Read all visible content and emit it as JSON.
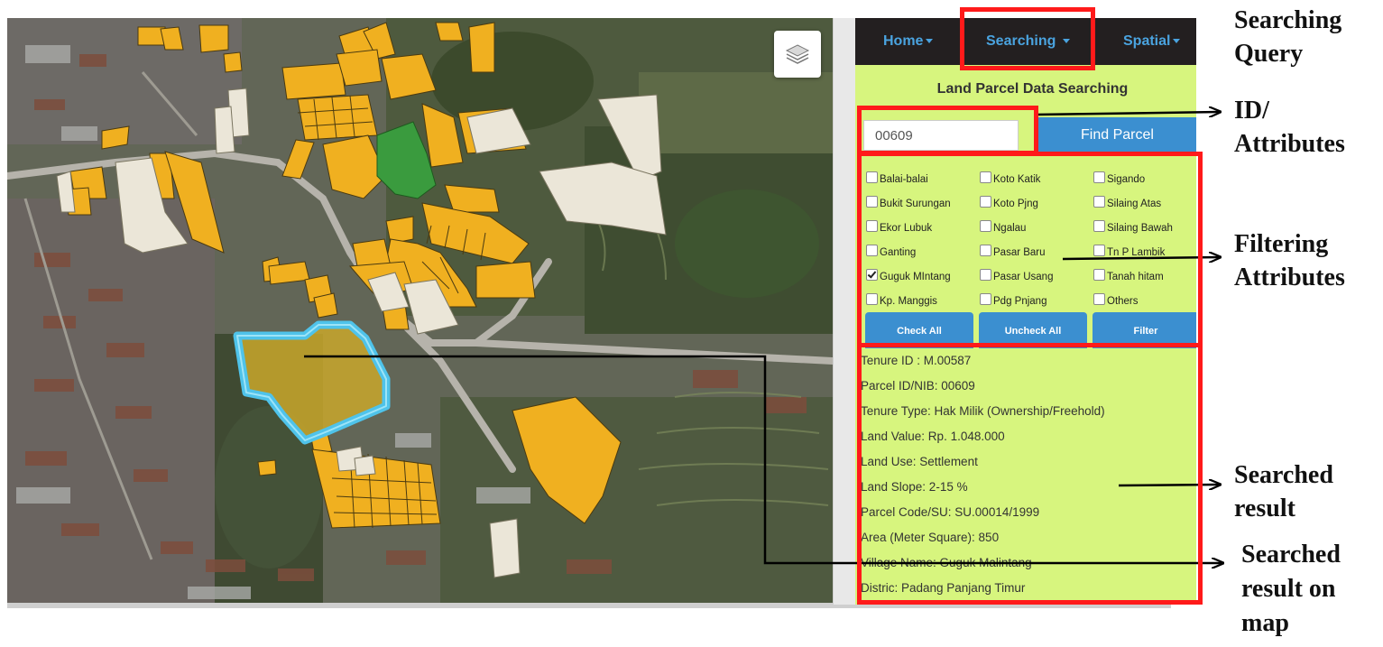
{
  "map": {
    "layers_button_icon": "layers-icon"
  },
  "nav": {
    "home": "Home",
    "searching": "Searching",
    "spatial": "Spatial"
  },
  "panel": {
    "title": "Land Parcel Data Searching",
    "id_input_value": "00609",
    "find_button": "Find Parcel"
  },
  "villages": [
    {
      "label": "Balai-balai",
      "checked": false
    },
    {
      "label": "Koto Katik",
      "checked": false
    },
    {
      "label": "Sigando",
      "checked": false
    },
    {
      "label": "Bukit Surungan",
      "checked": false
    },
    {
      "label": "Koto Pjng",
      "checked": false
    },
    {
      "label": "Silaing Atas",
      "checked": false
    },
    {
      "label": "Ekor Lubuk",
      "checked": false
    },
    {
      "label": "Ngalau",
      "checked": false
    },
    {
      "label": "Silaing Bawah",
      "checked": false
    },
    {
      "label": "Ganting",
      "checked": false
    },
    {
      "label": "Pasar Baru",
      "checked": false
    },
    {
      "label": "Tn P Lambik",
      "checked": false
    },
    {
      "label": "Guguk MIntang",
      "checked": true
    },
    {
      "label": "Pasar Usang",
      "checked": false
    },
    {
      "label": "Tanah hitam",
      "checked": false
    },
    {
      "label": "Kp. Manggis",
      "checked": false
    },
    {
      "label": "Pdg Pnjang",
      "checked": false
    },
    {
      "label": "Others",
      "checked": false
    }
  ],
  "buttons": {
    "check_all": "Check All",
    "uncheck_all": "Uncheck All",
    "filter": "Filter"
  },
  "result": [
    "Tenure ID : M.00587",
    "Parcel ID/NIB: 00609",
    "Tenure Type: Hak Milik (Ownership/Freehold)",
    "Land Value: Rp. 1.048.000",
    "Land Use: Settlement",
    "Land Slope: 2-15 %",
    "Parcel Code/SU: SU.00014/1999",
    "Area (Meter Square): 850",
    "Village Name: Guguk Malintang",
    "Distric: Padang Panjang Timur"
  ],
  "annotations": {
    "searching_query": [
      "Searching",
      "Query"
    ],
    "id_attributes": [
      "ID/",
      "Attributes"
    ],
    "filtering_attributes": [
      "Filtering",
      "Attributes"
    ],
    "searched_result": [
      "Searched",
      "result"
    ],
    "searched_result_on_map": [
      "Searched",
      "result on",
      "map"
    ]
  },
  "colors": {
    "parcel": "#f0b020",
    "parcel_pale": "#ebe6d8",
    "parcel_green": "#3a9b3e",
    "highlight": "#4fc3ea",
    "annotation_red": "#ff1a1a",
    "panel_bg": "#d7f57e",
    "navbar_bg": "#231f20",
    "button_blue": "#3b8fd0"
  }
}
